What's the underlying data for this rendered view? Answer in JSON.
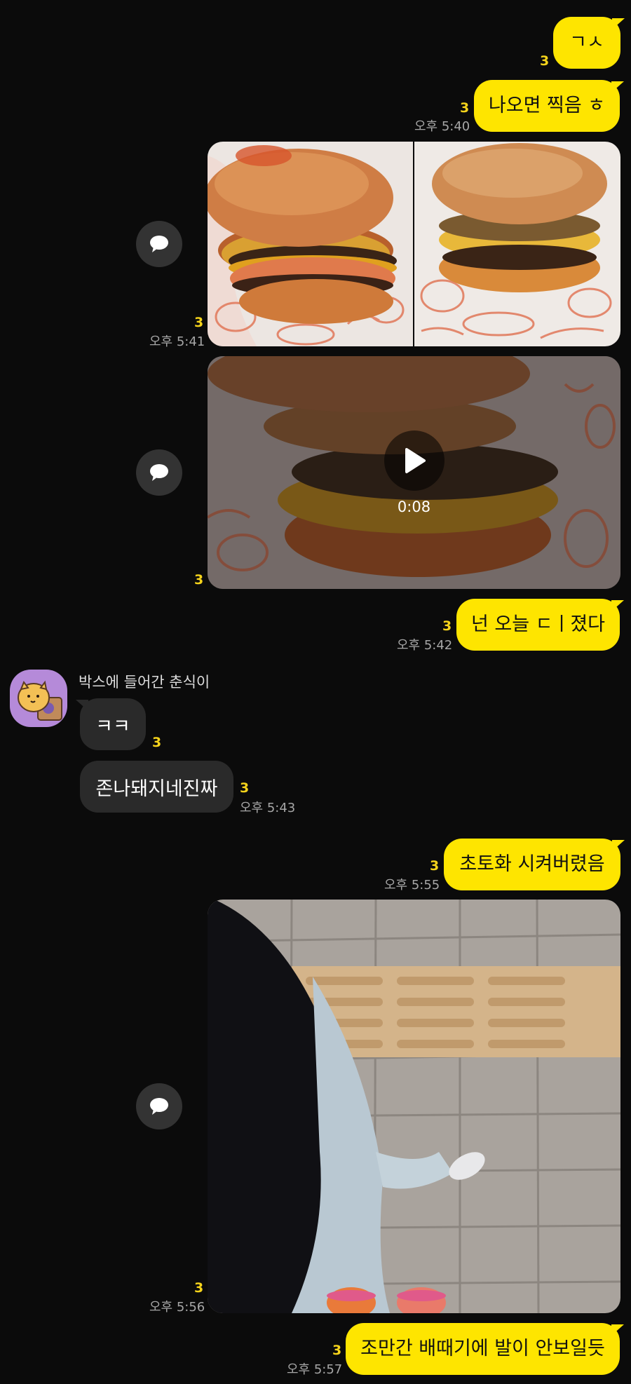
{
  "messages": {
    "m1": {
      "text": "ㄱㅅ",
      "unread": "3"
    },
    "m2": {
      "text": "나오면 찍음 ㅎ",
      "unread": "3",
      "time": "오후 5:40"
    },
    "photos1": {
      "unread": "3",
      "time": "오후 5:41"
    },
    "video": {
      "duration": "0:08",
      "unread": "3"
    },
    "m3": {
      "text": "넌 오늘 ㄷㅣ졌다",
      "unread": "3",
      "time": "오후 5:42"
    },
    "other": {
      "sender": "박스에 들어간 춘식이",
      "m1": {
        "text": "ㅋㅋ",
        "unread": "3"
      },
      "m2": {
        "text": "존나돼지네진짜",
        "unread": "3",
        "time": "오후 5:43"
      }
    },
    "m4": {
      "text": "초토화 시켜버렸음",
      "unread": "3",
      "time": "오후 5:55"
    },
    "photo2": {
      "unread": "3",
      "time": "오후 5:56"
    },
    "m5": {
      "text": "조만간 배때기에 발이 안보일듯",
      "unread": "3",
      "time": "오후 5:57"
    }
  },
  "icons": {
    "share": "share-chat-icon",
    "play": "play-icon"
  },
  "colors": {
    "background": "#0b0b0b",
    "my_bubble": "#fee500",
    "other_bubble": "#2a2a2a",
    "unread": "#f5d31b",
    "time": "#a6a6a6"
  }
}
